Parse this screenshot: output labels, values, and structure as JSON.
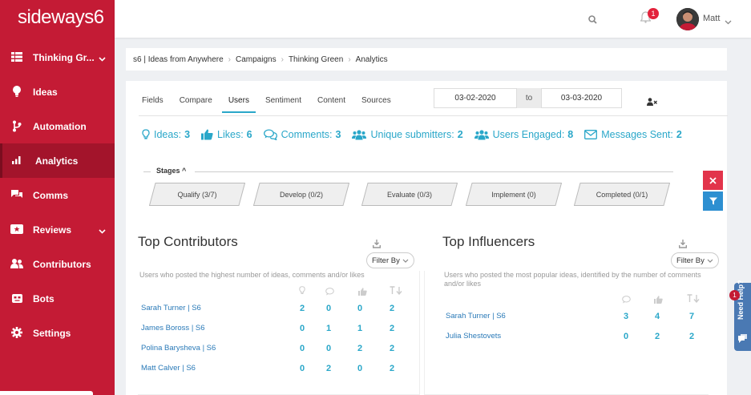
{
  "brand": {
    "logo": "sideways6",
    "accent": "#c41b35",
    "teal": "#2aa7c9"
  },
  "sidebar": {
    "items": [
      {
        "label": "Thinking Gr...",
        "icon": "grid-icon",
        "caret": true
      },
      {
        "label": "Ideas",
        "icon": "lightbulb-icon"
      },
      {
        "label": "Automation",
        "icon": "branch-icon"
      },
      {
        "label": "Analytics",
        "icon": "bar-chart-icon",
        "active": true
      },
      {
        "label": "Comms",
        "icon": "chat-icon"
      },
      {
        "label": "Reviews",
        "icon": "star-ticket-icon",
        "caret": true
      },
      {
        "label": "Contributors",
        "icon": "users-icon"
      },
      {
        "label": "Bots",
        "icon": "robot-icon"
      },
      {
        "label": "Settings",
        "icon": "gear-icon"
      }
    ]
  },
  "topbar": {
    "notification_count": "1",
    "user_name": "Matt"
  },
  "breadcrumb": [
    "s6 | Ideas from Anywhere",
    "Campaigns",
    "Thinking Green",
    "Analytics"
  ],
  "tabs": [
    {
      "label": "Fields"
    },
    {
      "label": "Compare"
    },
    {
      "label": "Users",
      "active": true
    },
    {
      "label": "Sentiment"
    },
    {
      "label": "Content"
    },
    {
      "label": "Sources"
    }
  ],
  "date_range": {
    "from": "03-02-2020",
    "to_label": "to",
    "to": "03-03-2020"
  },
  "stats": [
    {
      "label": "Ideas:",
      "value": "3",
      "icon": "lightbulb-icon"
    },
    {
      "label": "Likes:",
      "value": "6",
      "icon": "thumbs-up-icon"
    },
    {
      "label": "Comments:",
      "value": "3",
      "icon": "comments-icon"
    },
    {
      "label": "Unique submitters:",
      "value": "2",
      "icon": "users-icon"
    },
    {
      "label": "Users Engaged:",
      "value": "8",
      "icon": "users-icon"
    },
    {
      "label": "Messages Sent:",
      "value": "2",
      "icon": "envelope-icon"
    }
  ],
  "stages": {
    "label": "Stages",
    "items": [
      "Qualify (3/7)",
      "Develop (0/2)",
      "Evaluate (0/3)",
      "Implement (0)",
      "Completed (0/1)"
    ]
  },
  "contributors": {
    "title": "Top Contributors",
    "filter_label": "Filter By",
    "description": "Users who posted the highest number of ideas, comments and/or likes",
    "rows": [
      {
        "name": "Sarah Turner | S6",
        "values": [
          "2",
          "0",
          "0",
          "2"
        ]
      },
      {
        "name": "James Boross | S6",
        "values": [
          "0",
          "1",
          "1",
          "2"
        ]
      },
      {
        "name": "Polina Barysheva | S6",
        "values": [
          "0",
          "0",
          "2",
          "2"
        ]
      },
      {
        "name": "Matt Calver | S6",
        "values": [
          "0",
          "2",
          "0",
          "2"
        ]
      }
    ]
  },
  "influencers": {
    "title": "Top Influencers",
    "filter_label": "Filter By",
    "description": "Users who posted the most popular ideas, identified by the number of comments and/or likes",
    "rows": [
      {
        "name": "Sarah Turner | S6",
        "values": [
          "3",
          "4",
          "7"
        ]
      },
      {
        "name": "Julia Shestovets",
        "values": [
          "0",
          "2",
          "2"
        ]
      }
    ]
  },
  "help": {
    "label": "Need Help?",
    "badge": "1"
  }
}
